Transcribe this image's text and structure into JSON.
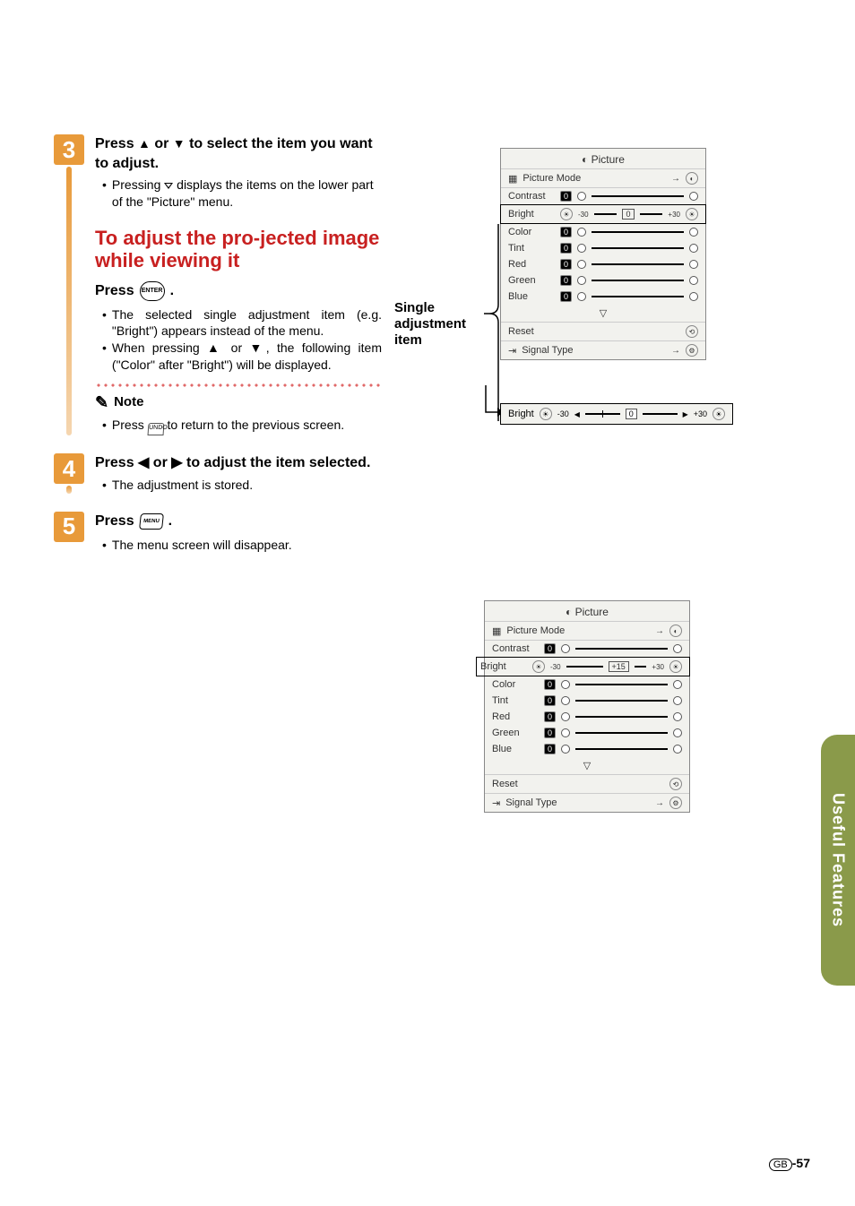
{
  "sideTab": "Useful Features",
  "pageNumber": {
    "region": "GB",
    "num": "-57"
  },
  "step3": {
    "number": "3",
    "title_a": "Press ",
    "title_b": " or ",
    "title_c": " to select the item you want to adjust.",
    "bullet1_a": "Pressing ",
    "bullet1_b": " displays the items on the lower part of the \"Picture\" menu."
  },
  "redHeading": "To adjust the pro-jected image while viewing it",
  "pressEnter": {
    "label_a": "Press ",
    "label_b": "."
  },
  "afterEnter": {
    "b1": "The selected single adjustment item (e.g. \"Bright\") appears instead of the menu.",
    "b2_a": "When pressing ",
    "b2_b": " or ",
    "b2_c": ", the following item (\"Color\" after \"Bright\") will be displayed."
  },
  "note": {
    "label": "Note",
    "text_a": "Press ",
    "text_b": " to return to the previous screen."
  },
  "step4": {
    "number": "4",
    "title_a": "Press ",
    "title_b": " or ",
    "title_c": " to adjust the item selected.",
    "bullet": "The adjustment is stored."
  },
  "step5": {
    "number": "5",
    "title_a": "Press ",
    "title_b": ".",
    "bullet": "The menu screen will disappear."
  },
  "singleAdjLabel": "Single adjustment item",
  "osd1": {
    "title": "Picture",
    "pictureMode": "Picture Mode",
    "rows": {
      "contrast": {
        "label": "Contrast",
        "val": "0"
      },
      "bright": {
        "label": "Bright",
        "val": "0",
        "minus": "-30",
        "plus": "+30"
      },
      "color": {
        "label": "Color",
        "val": "0"
      },
      "tint": {
        "label": "Tint",
        "val": "0"
      },
      "red": {
        "label": "Red",
        "val": "0"
      },
      "green": {
        "label": "Green",
        "val": "0"
      },
      "blue": {
        "label": "Blue",
        "val": "0"
      }
    },
    "reset": "Reset",
    "signalType": "Signal Type"
  },
  "brightDetail": {
    "label": "Bright",
    "minus": "-30",
    "val": "0",
    "plus": "+30"
  },
  "osd2": {
    "title": "Picture",
    "pictureMode": "Picture Mode",
    "rows": {
      "contrast": {
        "label": "Contrast",
        "val": "0"
      },
      "bright": {
        "label": "Bright",
        "val": "+15",
        "minus": "-30",
        "plus": "+30"
      },
      "color": {
        "label": "Color",
        "val": "0"
      },
      "tint": {
        "label": "Tint",
        "val": "0"
      },
      "red": {
        "label": "Red",
        "val": "0"
      },
      "green": {
        "label": "Green",
        "val": "0"
      },
      "blue": {
        "label": "Blue",
        "val": "0"
      }
    },
    "reset": "Reset",
    "signalType": "Signal Type"
  }
}
